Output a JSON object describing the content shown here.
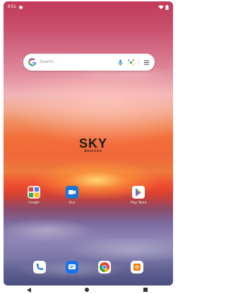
{
  "status_bar": {
    "time": "8:51"
  },
  "search": {
    "placeholder": "Search..."
  },
  "logo": {
    "main": "SKY",
    "sub": "devices"
  },
  "apps": [
    {
      "label": "Google",
      "icon": "google-folder-icon"
    },
    {
      "label": "Duo",
      "icon": "duo-icon"
    },
    {
      "label": "Play Store",
      "icon": "play-store-icon"
    }
  ],
  "dock": [
    {
      "icon": "phone-icon"
    },
    {
      "icon": "messages-icon"
    },
    {
      "icon": "chrome-icon"
    },
    {
      "icon": "camera-icon"
    }
  ],
  "nav": [
    {
      "icon": "back-icon"
    },
    {
      "icon": "home-icon"
    },
    {
      "icon": "recents-icon"
    }
  ],
  "colors": {
    "accent_blue": "#1a73e8",
    "duo_blue": "#1976d2",
    "sunset_orange": "#f0683a"
  }
}
